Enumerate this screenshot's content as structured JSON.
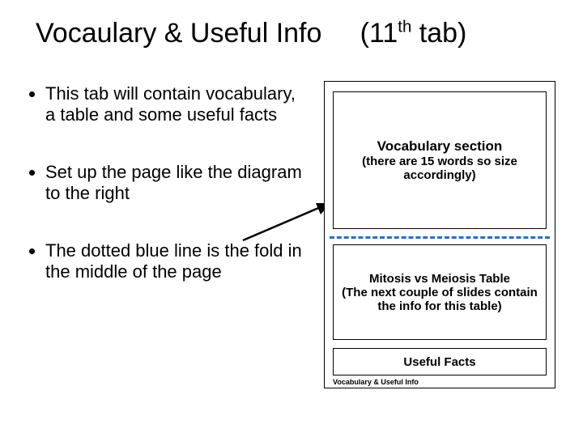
{
  "title": {
    "main": "Vocaulary & Useful Info",
    "paren_pre": "(11",
    "paren_sup": "th",
    "paren_post": " tab)"
  },
  "bullets": [
    "This tab will contain vocabulary, a table and some useful facts",
    "Set up the page like the diagram to the right",
    "The dotted blue line is the fold in the middle of the page"
  ],
  "diagram": {
    "vocab_header": "Vocabulary section",
    "vocab_sub": "(there are 15 words so size accordingly)",
    "mitosis_header": "Mitosis vs Meiosis Table",
    "mitosis_sub": "(The next couple of slides contain the info for this table)",
    "facts": "Useful Facts",
    "tab_label": "Vocabulary & Useful Info"
  }
}
